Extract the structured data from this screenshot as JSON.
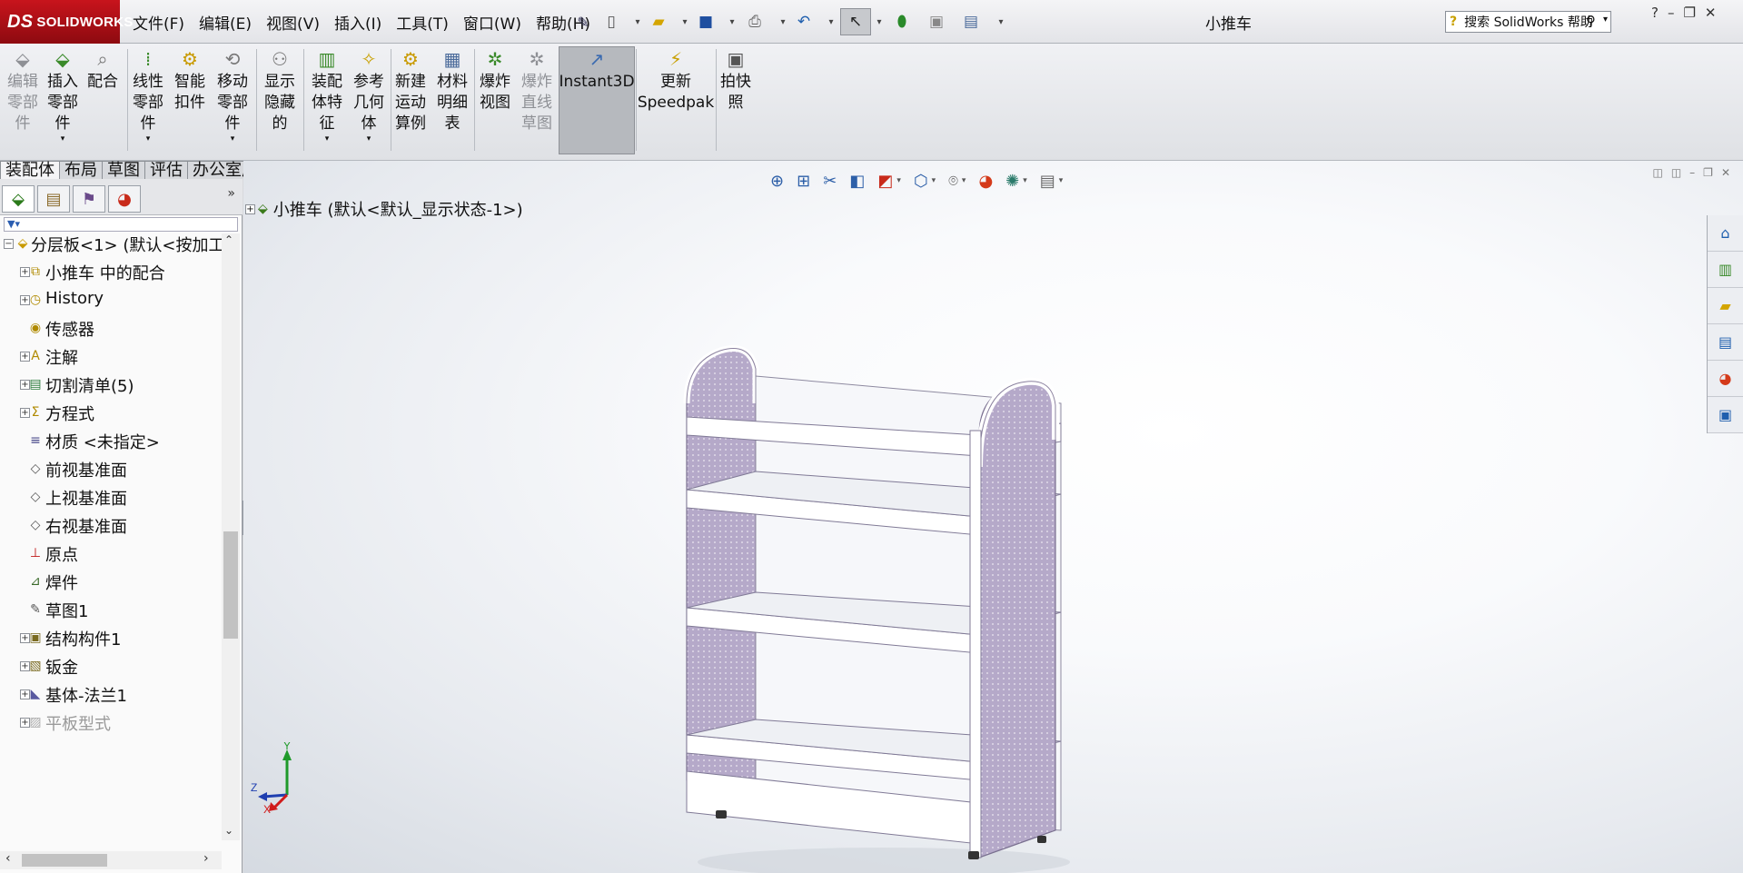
{
  "app": {
    "logo_ds": "DS",
    "logo_text": "SOLIDWORKS",
    "document_title": "小推车"
  },
  "menus": [
    "文件(F)",
    "编辑(E)",
    "视图(V)",
    "插入(I)",
    "工具(T)",
    "窗口(W)",
    "帮助(H)"
  ],
  "search": {
    "placeholder": "搜索 SolidWorks 帮助"
  },
  "window_controls": [
    "?",
    "–",
    "❐",
    "✕"
  ],
  "ribbon": {
    "buttons": [
      {
        "label": "编辑\n零部\n件",
        "icon": "edit-component-icon",
        "disabled": true
      },
      {
        "label": "插入\n零部\n件",
        "icon": "insert-component-icon",
        "disabled": false,
        "dropdown": true
      },
      {
        "label": "配合",
        "icon": "mate-icon",
        "disabled": false
      },
      {
        "label": "线性\n零部\n件",
        "icon": "linear-pattern-icon",
        "disabled": false,
        "dropdown": true
      },
      {
        "label": "智能\n扣件",
        "icon": "smart-fastener-icon",
        "disabled": false
      },
      {
        "label": "移动\n零部\n件",
        "icon": "move-component-icon",
        "disabled": false,
        "dropdown": true
      },
      {
        "label": "显示\n隐藏\n的",
        "icon": "show-hidden-icon",
        "disabled": false
      },
      {
        "label": "装配\n体特\n征",
        "icon": "assembly-feature-icon",
        "disabled": false,
        "dropdown": true
      },
      {
        "label": "参考\n几何\n体",
        "icon": "reference-geometry-icon",
        "disabled": false,
        "dropdown": true
      },
      {
        "label": "新建\n运动\n算例",
        "icon": "motion-study-icon",
        "disabled": false
      },
      {
        "label": "材料\n明细\n表",
        "icon": "bom-icon",
        "disabled": false
      },
      {
        "label": "爆炸\n视图",
        "icon": "exploded-view-icon",
        "disabled": false
      },
      {
        "label": "爆炸\n直线\n草图",
        "icon": "explode-line-sketch-icon",
        "disabled": true
      },
      {
        "label": "Instant3D",
        "icon": "instant3d-icon",
        "disabled": false,
        "active": true
      },
      {
        "label": "更新\nSpeedpak",
        "icon": "speedpak-icon",
        "disabled": false
      },
      {
        "label": "拍快\n照",
        "icon": "snapshot-icon",
        "disabled": false
      }
    ]
  },
  "cm_tabs": [
    "装配体",
    "布局",
    "草图",
    "评估",
    "办公室产品"
  ],
  "feature_tree": {
    "filter_icon": "filter-icon",
    "items": [
      {
        "label": "分层板<1> (默认<按加工",
        "icon": "part-icon",
        "expand": "−"
      },
      {
        "label": "小推车 中的配合",
        "icon": "mates-folder-icon",
        "expand": "+"
      },
      {
        "label": "History",
        "icon": "history-icon",
        "expand": "+"
      },
      {
        "label": "传感器",
        "icon": "sensors-icon",
        "expand": ""
      },
      {
        "label": "注解",
        "icon": "annotations-icon",
        "expand": "+"
      },
      {
        "label": "切割清单(5)",
        "icon": "cut-list-icon",
        "expand": "+"
      },
      {
        "label": "方程式",
        "icon": "equations-icon",
        "expand": "+"
      },
      {
        "label": "材质 <未指定>",
        "icon": "material-icon",
        "expand": ""
      },
      {
        "label": "前视基准面",
        "icon": "plane-icon",
        "expand": ""
      },
      {
        "label": "上视基准面",
        "icon": "plane-icon",
        "expand": ""
      },
      {
        "label": "右视基准面",
        "icon": "plane-icon",
        "expand": ""
      },
      {
        "label": "原点",
        "icon": "origin-icon",
        "expand": ""
      },
      {
        "label": "焊件",
        "icon": "weldment-icon",
        "expand": ""
      },
      {
        "label": "草图1",
        "icon": "sketch-icon",
        "expand": ""
      },
      {
        "label": "结构构件1",
        "icon": "structural-member-icon",
        "expand": "+"
      },
      {
        "label": "钣金",
        "icon": "sheet-metal-icon",
        "expand": "+"
      },
      {
        "label": "基体-法兰1",
        "icon": "base-flange-icon",
        "expand": "+"
      },
      {
        "label": "平板型式",
        "icon": "flat-pattern-icon",
        "expand": "+",
        "dim": true
      }
    ]
  },
  "viewport": {
    "assembly_node": "小推车  (默认<默认_显示状态-1>)",
    "triad": {
      "x": "X",
      "y": "Y",
      "z": "Z"
    }
  },
  "colors": {
    "accent": "#c8141c",
    "panel_purple": "#b3a7c7",
    "shelf": "#ffffff"
  }
}
